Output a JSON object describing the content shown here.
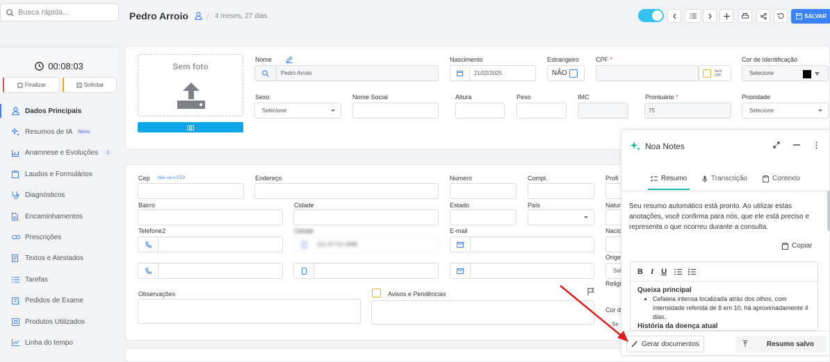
{
  "search": {
    "placeholder": "Busca rápida..."
  },
  "timer": {
    "value": "00:08:03",
    "finalize": "Finalizar",
    "request": "Solicitar"
  },
  "nav": [
    {
      "label": "Dados Principais",
      "icon": "user-icon",
      "active": true
    },
    {
      "label": "Resumos de IA",
      "icon": "sparkle-icon",
      "badge": "Novo"
    },
    {
      "label": "Anamnese e Evoluções",
      "icon": "chart-icon",
      "count": "1"
    },
    {
      "label": "Laudos e Formulários",
      "icon": "clipboard-icon"
    },
    {
      "label": "Diagnósticos",
      "icon": "stethoscope-icon"
    },
    {
      "label": "Encaminhamentos",
      "icon": "document-icon"
    },
    {
      "label": "Prescrições",
      "icon": "pills-icon"
    },
    {
      "label": "Textos e Atestados",
      "icon": "text-doc-icon"
    },
    {
      "label": "Tarefas",
      "icon": "list-icon"
    },
    {
      "label": "Pedidos de Exame",
      "icon": "lab-icon"
    },
    {
      "label": "Produtos Utilizados",
      "icon": "box-icon"
    },
    {
      "label": "Linha do tempo",
      "icon": "timeline-icon"
    }
  ],
  "header": {
    "patient": "Pedro Arroio",
    "age": "4 meses, 27 dias",
    "save": "SALVAR"
  },
  "form": {
    "no_photo": "Sem foto",
    "name_label": "Nome",
    "name_value": "Pedro Arroio",
    "birth_label": "Nascimento",
    "birth_value": "21/02/2025",
    "foreign_label": "Estrangeiro",
    "foreign_value": "NÃO",
    "cpf_label": "CPF",
    "required": "*",
    "no_cpf": "Sem CPF",
    "color_label": "Cor de Identificação",
    "color_value": "Selecione",
    "sex_label": "Sexo",
    "sex_value": "Selecione",
    "social_label": "Nome Social",
    "height_label": "Altura",
    "weight_label": "Peso",
    "imc_label": "IMC",
    "record_label": "Prontuário",
    "record_value": "75",
    "priority_label": "Prioridade",
    "priority_value": "Selecione",
    "cep_label": "Cep",
    "cep_link": "Não sei o CEP",
    "address_label": "Endereço",
    "number_label": "Número",
    "compl_label": "Compl.",
    "prof_label": "Profi",
    "district_label": "Bairro",
    "city_label": "Cidade",
    "state_label": "Estado",
    "country_label": "País",
    "natur_label": "Natur",
    "phone2_label": "Telefone2",
    "cell_label": "Celular",
    "cell_value": "(11) 97711-1888",
    "email_label": "E-mail",
    "nacio_label": "Nacio",
    "orig_label": "Orige",
    "orig_value": "Sel",
    "relig_label": "Religi",
    "obs_label": "Observações",
    "alerts_label": "Avisos e Pendências",
    "cor_label": "Cor d",
    "cor_value": "Se"
  },
  "noa": {
    "title": "Noa Notes",
    "tabs": [
      "Resumo",
      "Transcrição",
      "Contexto"
    ],
    "intro": "Seu resumo automático está pronto. Ao utilizar estas anotações, você confirma para nós, que ele está preciso e representa o que ocorreu durante a consulta.",
    "copy": "Copiar",
    "heading1": "Queixa principal",
    "bullet1": "Cefaleia intensa localizada atrás dos olhos, com intensidade referida de 8 em 10, há aproximadamente 4 dias.",
    "heading2": "História da doença atual",
    "generate": "Gerar documentos",
    "saved": "Resumo salvo"
  },
  "colors": {
    "accent": "#3b82f6",
    "toggle": "#34c3f0",
    "tab_underline": "#14b8a6",
    "arrow": "#e02020"
  }
}
